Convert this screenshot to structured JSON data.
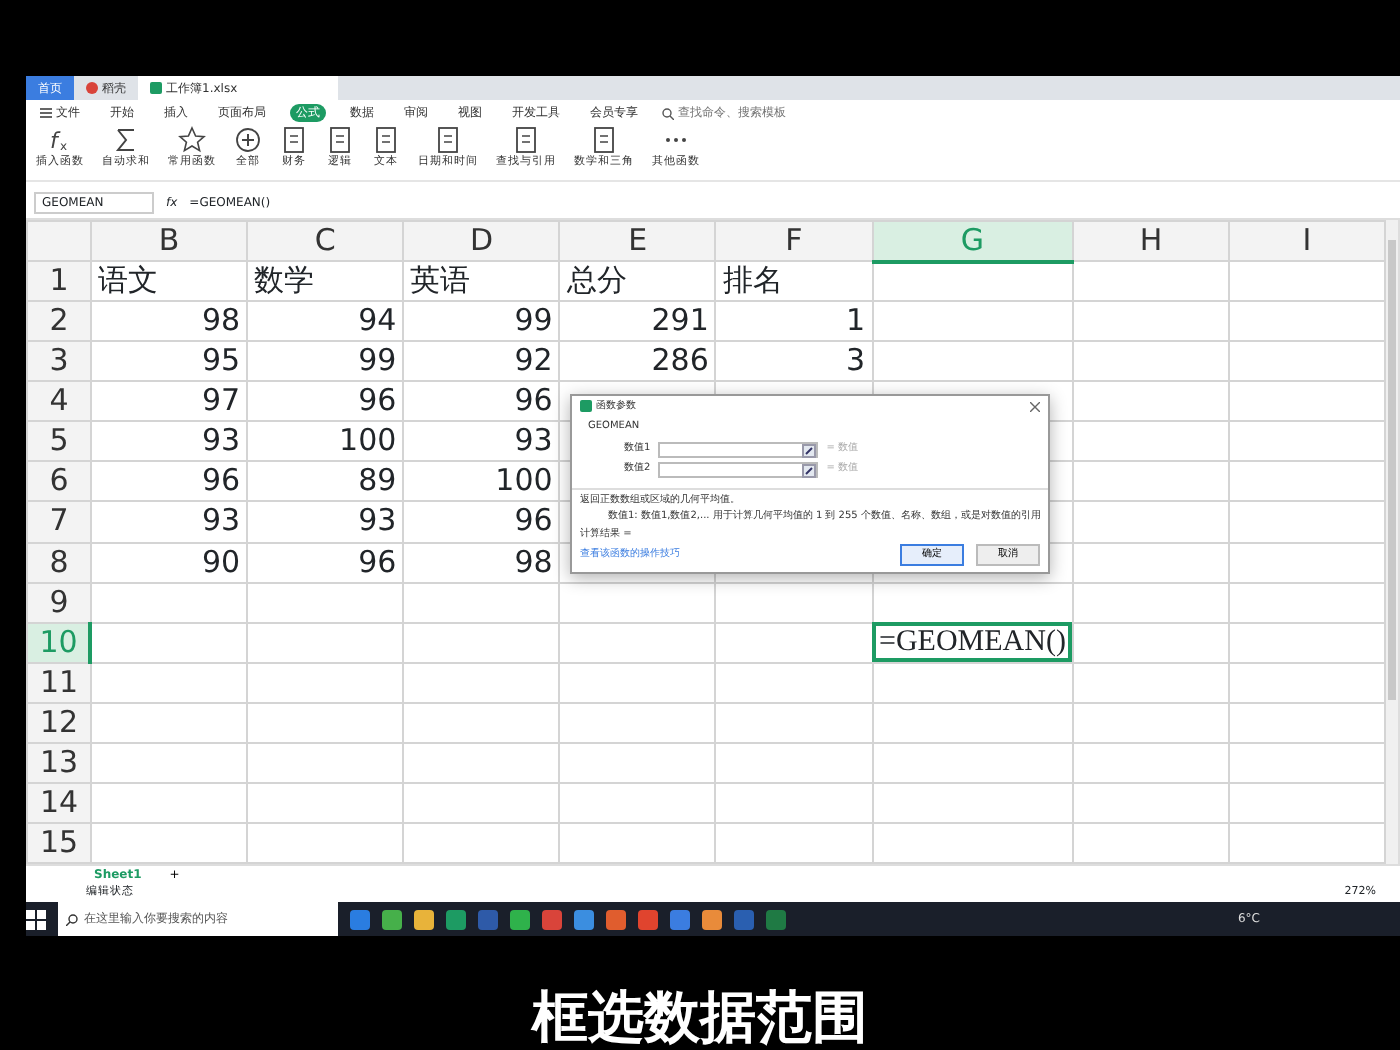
{
  "app_tabs": [
    {
      "label": "首页",
      "selected": false,
      "kind": "home"
    },
    {
      "label": "稻壳",
      "selected": false,
      "kind": "docer"
    },
    {
      "label": "工作簿1.xlsx",
      "selected": true,
      "kind": "sheet"
    }
  ],
  "file_menu": "文件",
  "menu_tabs": [
    {
      "label": "开始",
      "selected": false
    },
    {
      "label": "插入",
      "selected": false
    },
    {
      "label": "页面布局",
      "selected": false
    },
    {
      "label": "公式",
      "selected": true
    },
    {
      "label": "数据",
      "selected": false
    },
    {
      "label": "审阅",
      "selected": false
    },
    {
      "label": "视图",
      "selected": false
    },
    {
      "label": "开发工具",
      "selected": false
    },
    {
      "label": "会员专享",
      "selected": false
    }
  ],
  "search": {
    "placeholder": "查找命令、搜索模板"
  },
  "ribbon": [
    {
      "label": "插入函数",
      "kind": "fx"
    },
    {
      "label": "自动求和",
      "kind": "sum"
    },
    {
      "label": "常用函数",
      "kind": "star"
    },
    {
      "label": "全部",
      "kind": "circle"
    },
    {
      "label": "财务",
      "kind": "doc"
    },
    {
      "label": "逻辑",
      "kind": "doc"
    },
    {
      "label": "文本",
      "kind": "doc"
    },
    {
      "label": "日期和时间",
      "kind": "doc"
    },
    {
      "label": "查找与引用",
      "kind": "doc"
    },
    {
      "label": "数学和三角",
      "kind": "doc"
    },
    {
      "label": "其他函数",
      "kind": "more"
    }
  ],
  "formula_bar": {
    "name_box": "GEOMEAN",
    "fx_label": "fx",
    "formula": "=GEOMEAN()"
  },
  "sheet": {
    "columns": [
      {
        "label": "B",
        "selected": false
      },
      {
        "label": "C",
        "selected": false
      },
      {
        "label": "D",
        "selected": false
      },
      {
        "label": "E",
        "selected": false
      },
      {
        "label": "F",
        "selected": false
      },
      {
        "label": "G",
        "selected": true
      },
      {
        "label": "H",
        "selected": false
      },
      {
        "label": "I",
        "selected": false
      }
    ],
    "rows": [
      {
        "number": "1",
        "selected": false,
        "cells": {
          "B": {
            "text": "语文",
            "kind": "text"
          },
          "C": {
            "text": "数学",
            "kind": "text"
          },
          "D": {
            "text": "英语",
            "kind": "text"
          },
          "E": {
            "text": "总分",
            "kind": "text"
          },
          "F": {
            "text": "排名",
            "kind": "text"
          }
        }
      },
      {
        "number": "2",
        "selected": false,
        "cells": {
          "B": {
            "text": "98",
            "kind": "number"
          },
          "C": {
            "text": "94",
            "kind": "number"
          },
          "D": {
            "text": "99",
            "kind": "number"
          },
          "E": {
            "text": "291",
            "kind": "number"
          },
          "F": {
            "text": "1",
            "kind": "number"
          }
        }
      },
      {
        "number": "3",
        "selected": false,
        "cells": {
          "B": {
            "text": "95",
            "kind": "number"
          },
          "C": {
            "text": "99",
            "kind": "number"
          },
          "D": {
            "text": "92",
            "kind": "number"
          },
          "E": {
            "text": "286",
            "kind": "number"
          },
          "F": {
            "text": "3",
            "kind": "number"
          }
        }
      },
      {
        "number": "4",
        "selected": false,
        "cells": {
          "B": {
            "text": "97",
            "kind": "number"
          },
          "C": {
            "text": "96",
            "kind": "number"
          },
          "D": {
            "text": "96",
            "kind": "number"
          }
        }
      },
      {
        "number": "5",
        "selected": false,
        "cells": {
          "B": {
            "text": "93",
            "kind": "number"
          },
          "C": {
            "text": "100",
            "kind": "number"
          },
          "D": {
            "text": "93",
            "kind": "number"
          }
        }
      },
      {
        "number": "6",
        "selected": false,
        "cells": {
          "B": {
            "text": "96",
            "kind": "number"
          },
          "C": {
            "text": "89",
            "kind": "number"
          },
          "D": {
            "text": "100",
            "kind": "number"
          }
        }
      },
      {
        "number": "7",
        "selected": false,
        "cells": {
          "B": {
            "text": "93",
            "kind": "number"
          },
          "C": {
            "text": "93",
            "kind": "number"
          },
          "D": {
            "text": "96",
            "kind": "number"
          }
        }
      },
      {
        "number": "8",
        "selected": false,
        "cells": {
          "B": {
            "text": "90",
            "kind": "number"
          },
          "C": {
            "text": "96",
            "kind": "number"
          },
          "D": {
            "text": "98",
            "kind": "number"
          }
        }
      },
      {
        "number": "9",
        "selected": false,
        "cells": {}
      },
      {
        "number": "10",
        "selected": true,
        "cells": {
          "G": {
            "text": "=GEOMEAN()",
            "kind": "formula",
            "selected": true
          }
        }
      },
      {
        "number": "11",
        "selected": false,
        "cells": {}
      },
      {
        "number": "12",
        "selected": false,
        "cells": {}
      },
      {
        "number": "13",
        "selected": false,
        "cells": {}
      },
      {
        "number": "14",
        "selected": false,
        "cells": {}
      },
      {
        "number": "15",
        "selected": false,
        "cells": {}
      }
    ]
  },
  "dialog": {
    "title": "函数参数",
    "function": "GEOMEAN",
    "args": [
      {
        "label": "数值1",
        "result": "= 数值"
      },
      {
        "label": "数值2",
        "result": "= 数值"
      }
    ],
    "description": "返回正数数组或区域的几何平均值。",
    "detail": "数值1:  数值1,数值2,... 用于计算几何平均值的 1 到 255 个数值、名称、数组，或是对数值的引用",
    "result_label": "计算结果 =",
    "help_link": "查看该函数的操作技巧",
    "buttons": [
      {
        "label": "确定",
        "kind": "primary"
      },
      {
        "label": "取消",
        "kind": "secondary"
      }
    ]
  },
  "sheet_tabs": [
    {
      "label": "Sheet1",
      "selected": true
    }
  ],
  "add_sheet": "+",
  "status_bar": {
    "status": "编辑状态",
    "zoom": "272%"
  },
  "taskbar": {
    "search_placeholder": "在这里输入你要搜索的内容",
    "temperature": "6°C"
  },
  "subtitle": "框选数据范围"
}
